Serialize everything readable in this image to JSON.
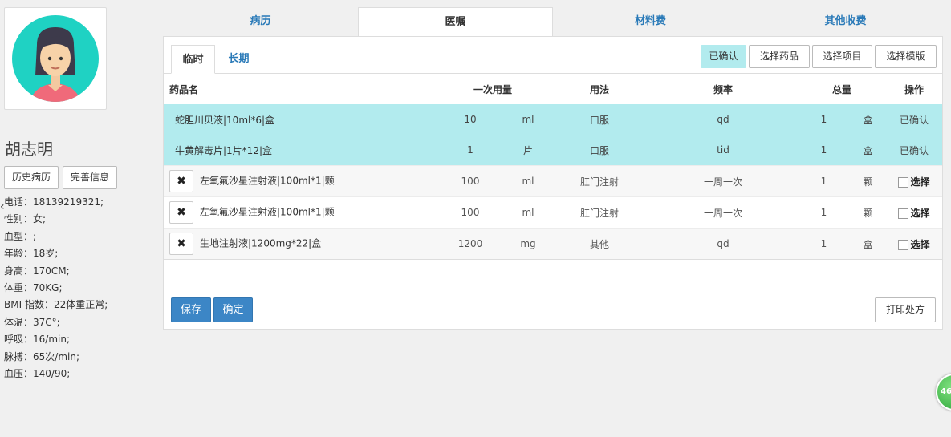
{
  "patient": {
    "name": "胡志明",
    "buttons": {
      "history": "历史病历",
      "complete_info": "完善信息"
    },
    "info": [
      "电话：18139219321;",
      "性别：女;",
      "血型：;",
      "年龄：18岁;",
      "身高：170CM;",
      "体重：70KG;",
      "BMI 指数：22体重正常;",
      "体温：37C°;",
      "呼吸：16/min;",
      "脉搏：65次/min;",
      "血压：140/90;"
    ]
  },
  "top_tabs": [
    "病历",
    "医嘱",
    "材料费",
    "其他收费"
  ],
  "sub_tabs": [
    "临时",
    "长期"
  ],
  "toolbar": {
    "confirmed": "已确认",
    "select_drug": "选择药品",
    "select_item": "选择项目",
    "select_template": "选择模版"
  },
  "table": {
    "headers": [
      "药品名",
      "一次用量",
      "用法",
      "频率",
      "总量",
      "操作"
    ],
    "rows": [
      {
        "name": "蛇胆川贝液|10ml*6|盒",
        "dose": "10",
        "dose_unit": "ml",
        "usage": "口服",
        "freq": "qd",
        "total": "1",
        "total_unit": "盒",
        "op": "已确认"
      },
      {
        "name": "牛黄解毒片|1片*12|盒",
        "dose": "1",
        "dose_unit": "片",
        "usage": "口服",
        "freq": "tid",
        "total": "1",
        "total_unit": "盒",
        "op": "已确认"
      },
      {
        "name": "左氧氟沙星注射液|100ml*1|颗",
        "dose": "100",
        "dose_unit": "ml",
        "usage": "肛门注射",
        "freq": "一周一次",
        "total": "1",
        "total_unit": "颗",
        "op": "选择"
      },
      {
        "name": "左氧氟沙星注射液|100ml*1|颗",
        "dose": "100",
        "dose_unit": "ml",
        "usage": "肛门注射",
        "freq": "一周一次",
        "total": "1",
        "total_unit": "颗",
        "op": "选择"
      },
      {
        "name": "生地注射液|1200mg*22|盒",
        "dose": "1200",
        "dose_unit": "mg",
        "usage": "其他",
        "freq": "qd",
        "total": "1",
        "total_unit": "盒",
        "op": "选择"
      }
    ]
  },
  "footer": {
    "save": "保存",
    "ok": "确定",
    "print": "打印处方"
  },
  "badge": "46",
  "icons": {
    "delete": "✖",
    "collapse": "‹"
  },
  "colors": {
    "accent": "#3c86c6",
    "confirmed_row": "#b2ebee",
    "tab_text": "#2a7ab8"
  }
}
